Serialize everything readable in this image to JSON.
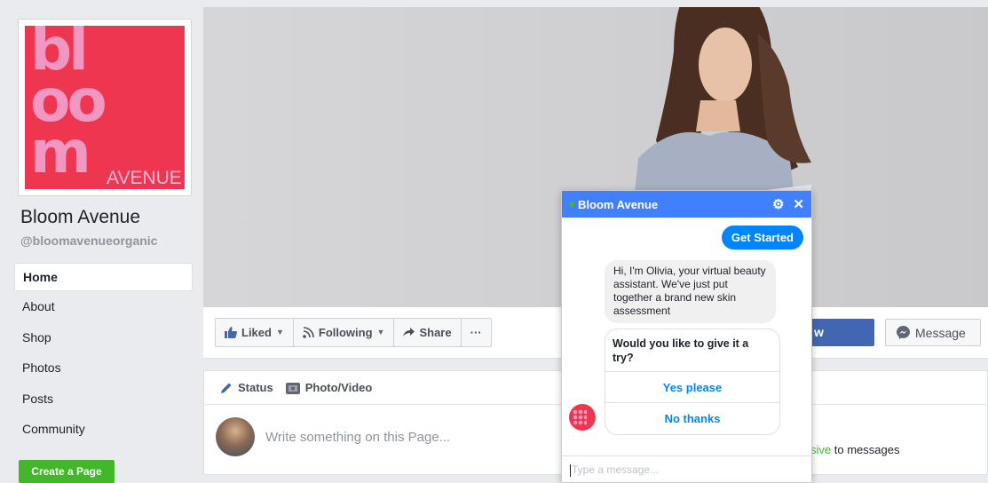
{
  "page": {
    "name": "Bloom Avenue",
    "handle": "@bloomavenueorganic",
    "logo": {
      "line1": "bl",
      "line2": "oo",
      "line3": "m",
      "word": "AVENUE",
      "bg_color": "#ee3650",
      "text_color": "#f197c2"
    }
  },
  "sidebar": {
    "items": [
      {
        "label": "Home",
        "active": true
      },
      {
        "label": "About"
      },
      {
        "label": "Shop"
      },
      {
        "label": "Photos"
      },
      {
        "label": "Posts"
      },
      {
        "label": "Community"
      }
    ],
    "create_page": "Create a Page"
  },
  "action_bar": {
    "liked": "Liked",
    "following": "Following",
    "share": "Share",
    "more": "···",
    "send_partial": "w",
    "message": "Message"
  },
  "composer": {
    "tab_status": "Status",
    "tab_photo": "Photo/Video",
    "placeholder": "Write something on this Page...",
    "responsive_partial": "sive",
    "responsive_rest": " to messages"
  },
  "chat": {
    "title": "Bloom Avenue",
    "header_color": "#4080ff",
    "get_started": "Get Started",
    "bot_message": "Hi, I'm Olivia, your virtual beauty assistant.  We've just put together a brand new skin assessment",
    "question": "Would you like to give it a try?",
    "option_yes": "Yes please",
    "option_no": "No thanks",
    "input_placeholder": "Type a message..."
  }
}
